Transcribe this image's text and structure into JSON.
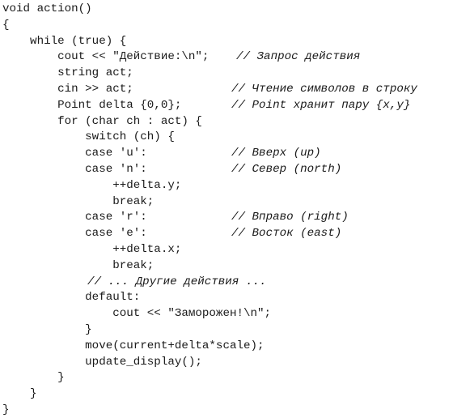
{
  "code": {
    "lines": [
      {
        "text": "void action()",
        "comment": ""
      },
      {
        "text": "{",
        "comment": ""
      },
      {
        "text": "    while (true) {",
        "comment": ""
      },
      {
        "text": "        cout << \"Действие:\\n\"; ",
        "comment": "// Запрос действия"
      },
      {
        "text": "        string act;",
        "comment": ""
      },
      {
        "text": "        cin >> act;",
        "comment": "// Чтение символов в строку"
      },
      {
        "text": "        Point delta {0,0};",
        "comment": "// Point хранит пару {x,y}"
      },
      {
        "text": "        for (char ch : act) {",
        "comment": ""
      },
      {
        "text": "            switch (ch) {",
        "comment": ""
      },
      {
        "text": "            case 'u':",
        "comment": "// Вверх (up)"
      },
      {
        "text": "            case 'n':",
        "comment": "// Север (north)"
      },
      {
        "text": "                ++delta.y;",
        "comment": ""
      },
      {
        "text": "                break;",
        "comment": ""
      },
      {
        "text": "            case 'r':",
        "comment": "// Вправо (right)"
      },
      {
        "text": "            case 'e':",
        "comment": "// Восток (east)"
      },
      {
        "text": "                ++delta.x;",
        "comment": ""
      },
      {
        "text": "                break;",
        "comment": ""
      },
      {
        "text": "            ",
        "comment": "// ... Другие действия ..."
      },
      {
        "text": "            default:",
        "comment": ""
      },
      {
        "text": "                cout << \"Заморожен!\\n\";",
        "comment": ""
      },
      {
        "text": "            }",
        "comment": ""
      },
      {
        "text": "            move(current+delta*scale);",
        "comment": ""
      },
      {
        "text": "            update_display();",
        "comment": ""
      },
      {
        "text": "        }",
        "comment": ""
      },
      {
        "text": "    }",
        "comment": ""
      },
      {
        "text": "}",
        "comment": ""
      }
    ]
  }
}
